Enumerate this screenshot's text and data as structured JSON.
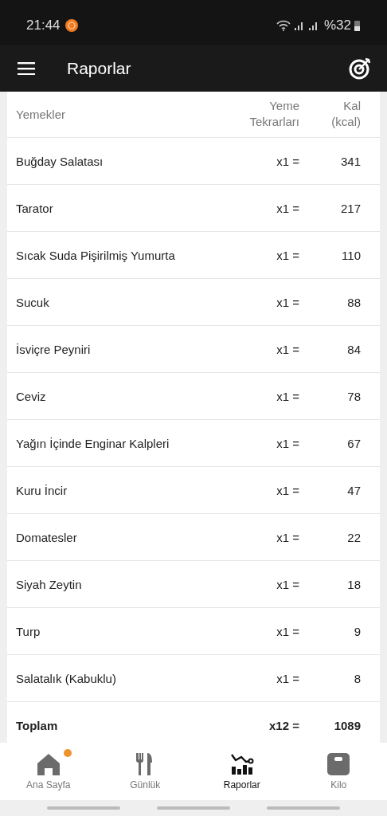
{
  "status_bar": {
    "time": "21:44",
    "battery": "%32"
  },
  "app_bar": {
    "title": "Raporlar"
  },
  "table": {
    "columns": [
      "Yemekler",
      "Yeme Tekrarları",
      "Kal (kcal)"
    ],
    "rows": [
      {
        "food": "Buğday Salatası",
        "count": "x1 =",
        "kcal": "341"
      },
      {
        "food": "Tarator",
        "count": "x1 =",
        "kcal": "217"
      },
      {
        "food": "Sıcak Suda Pişirilmiş Yumurta",
        "count": "x1 =",
        "kcal": "110"
      },
      {
        "food": "Sucuk",
        "count": "x1 =",
        "kcal": "88"
      },
      {
        "food": "İsviçre Peyniri",
        "count": "x1 =",
        "kcal": "84"
      },
      {
        "food": "Ceviz",
        "count": "x1 =",
        "kcal": "78"
      },
      {
        "food": "Yağın İçinde Enginar Kalpleri",
        "count": "x1 =",
        "kcal": "67"
      },
      {
        "food": "Kuru İncir",
        "count": "x1 =",
        "kcal": "47"
      },
      {
        "food": "Domatesler",
        "count": "x1 =",
        "kcal": "22"
      },
      {
        "food": "Siyah Zeytin",
        "count": "x1 =",
        "kcal": "18"
      },
      {
        "food": "Turp",
        "count": "x1 =",
        "kcal": "9"
      },
      {
        "food": "Salatalık (Kabuklu)",
        "count": "x1 =",
        "kcal": "8"
      }
    ],
    "total": {
      "label": "Toplam",
      "count": "x12 =",
      "kcal": "1089"
    }
  },
  "bottom_nav": [
    {
      "kind": "home",
      "label": "Ana Sayfa",
      "selected": false,
      "badge": true
    },
    {
      "kind": "diary",
      "label": "Günlük",
      "selected": false,
      "badge": false
    },
    {
      "kind": "reports",
      "label": "Raporlar",
      "selected": true,
      "badge": false
    },
    {
      "kind": "weight",
      "label": "Kilo",
      "selected": false,
      "badge": false
    }
  ]
}
